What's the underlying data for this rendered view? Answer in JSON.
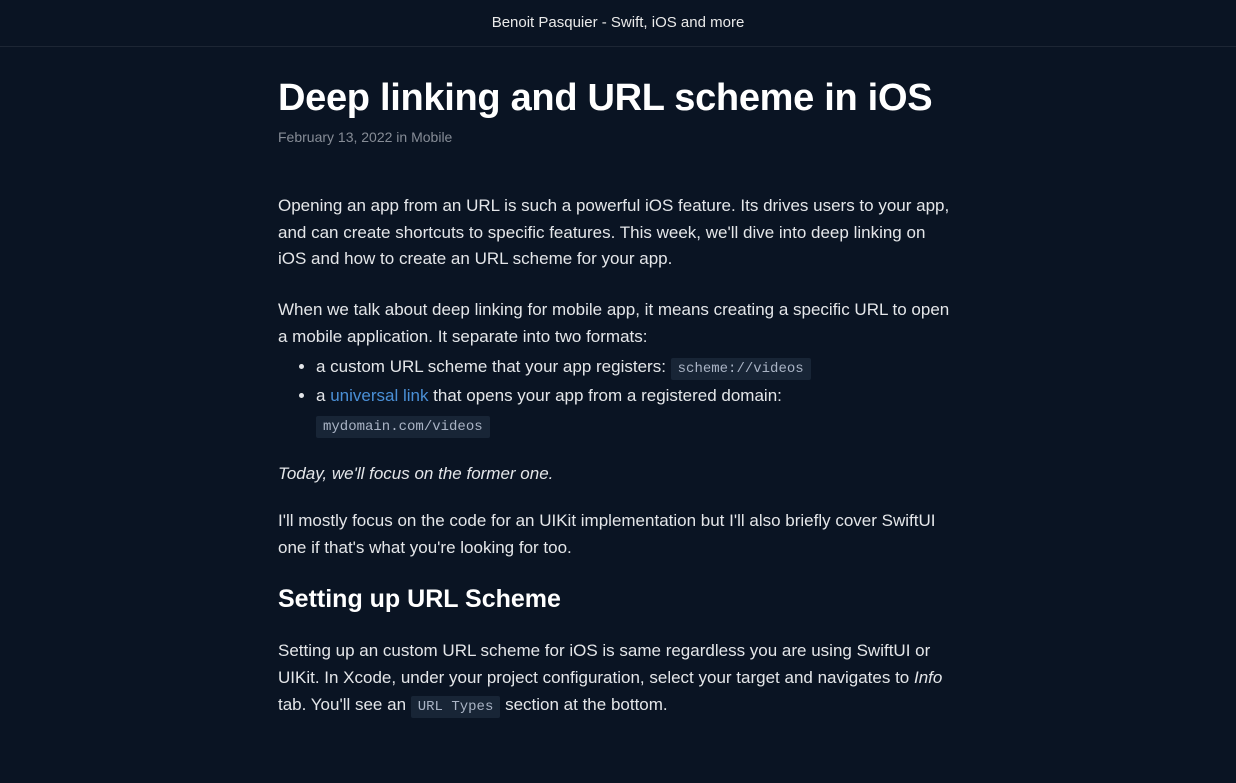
{
  "header": {
    "site_title": "Benoit Pasquier - Swift, iOS and more"
  },
  "article": {
    "title": "Deep linking and URL scheme in iOS",
    "date": "February 13, 2022",
    "in_word": "in",
    "category": "Mobile",
    "intro": "Opening an app from an URL is such a powerful iOS feature. Its drives users to your app, and can create shortcuts to specific features. This week, we'll dive into deep linking on iOS and how to create an URL scheme for your app.",
    "para2": "When we talk about deep linking for mobile app, it means creating a specific URL to open a mobile application. It separate into two formats:",
    "bullets": {
      "b1_pre": "a custom URL scheme that your app registers: ",
      "b1_code": "scheme://videos",
      "b2_pre": "a ",
      "b2_link": "universal link",
      "b2_post": " that opens your app from a registered domain: ",
      "b2_code": "mydomain.com/videos"
    },
    "focus": "Today, we'll focus on the former one.",
    "para3": "I'll mostly focus on the code for an UIKit implementation but I'll also briefly cover SwiftUI one if that's what you're looking for too.",
    "h2": "Setting up URL Scheme",
    "para4_pre": "Setting up an custom URL scheme for iOS is same regardless you are using SwiftUI or UIKit. In Xcode, under your project configuration, select your target and navigates to ",
    "para4_info": "Info",
    "para4_mid": " tab. You'll see an ",
    "para4_code": "URL Types",
    "para4_post": " section at the bottom."
  }
}
